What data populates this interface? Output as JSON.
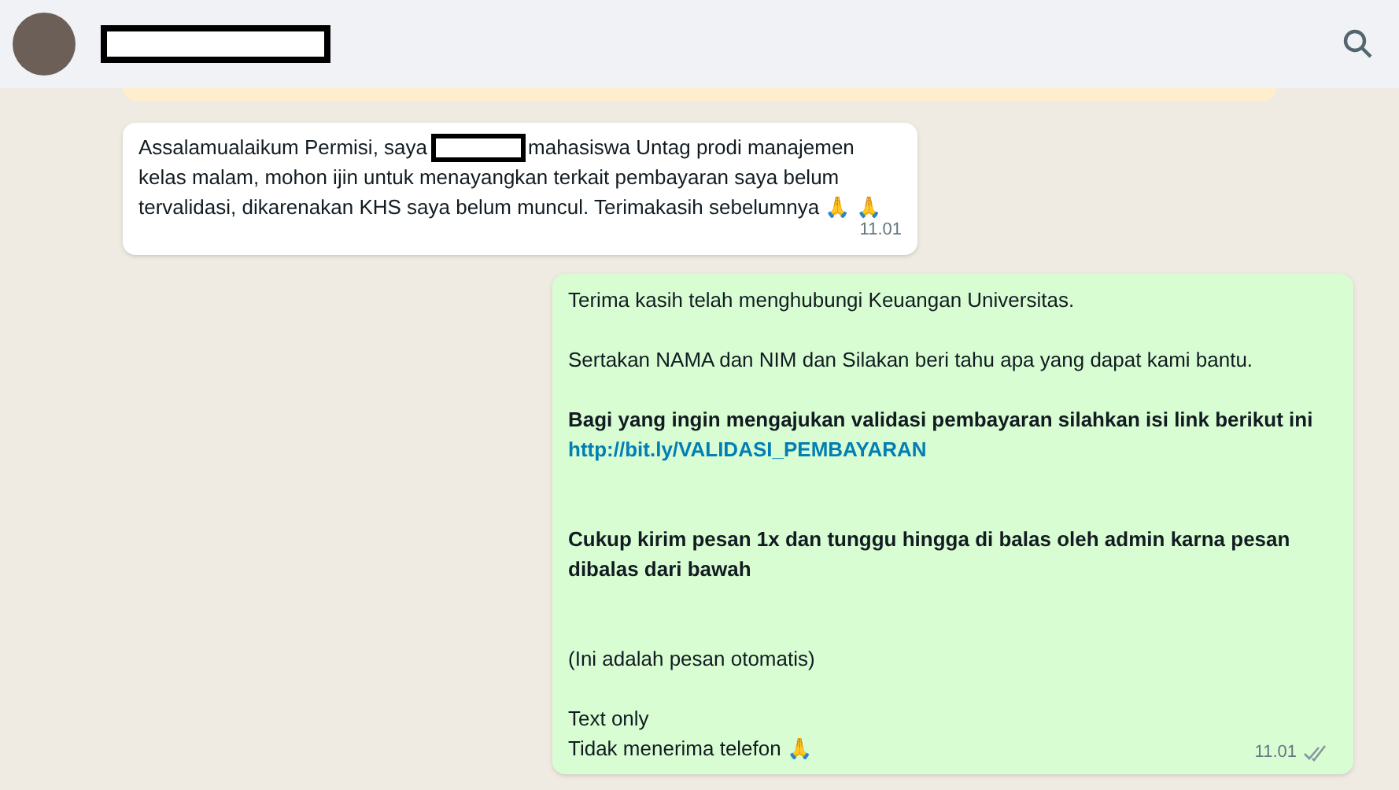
{
  "messages": [
    {
      "kind": "incoming",
      "time": "11.01",
      "parts": [
        {
          "kind": "text",
          "text": "Assalamualaikum Permisi, saya"
        },
        {
          "kind": "redacted"
        },
        {
          "kind": "text",
          "text": "mahasiswa Untag prodi manajemen"
        },
        {
          "kind": "paragraph",
          "text": "kelas malam, mohon ijin untuk menayangkan terkait pembayaran saya belum tervalidasi, dikarenakan KHS saya belum muncul. Terimakasih sebelumnya 🙏 🙏"
        }
      ]
    },
    {
      "kind": "outgoing",
      "time": "11.01",
      "read": false,
      "parts": [
        {
          "kind": "text",
          "text": "Terima kasih telah menghubungi Keuangan Universitas."
        },
        {
          "kind": "blank"
        },
        {
          "kind": "text",
          "text": "Sertakan NAMA dan NIM dan Silakan beri tahu apa yang dapat kami bantu."
        },
        {
          "kind": "blank"
        },
        {
          "kind": "bold",
          "text": "Bagi yang ingin mengajukan validasi pembayaran silahkan isi link berikut ini",
          "link": "http://bit.ly/VALIDASI_PEMBAYARAN"
        },
        {
          "kind": "blank"
        },
        {
          "kind": "blank"
        },
        {
          "kind": "bold",
          "text": "Cukup kirim pesan 1x dan tunggu hingga di balas oleh admin karna pesan dibalas dari bawah"
        },
        {
          "kind": "blank"
        },
        {
          "kind": "blank"
        },
        {
          "kind": "text",
          "text": "(Ini adalah pesan otomatis)"
        },
        {
          "kind": "blank"
        },
        {
          "kind": "text",
          "text": "Text only"
        },
        {
          "kind": "text",
          "text": "Tidak menerima telefon 🙏"
        }
      ]
    }
  ]
}
